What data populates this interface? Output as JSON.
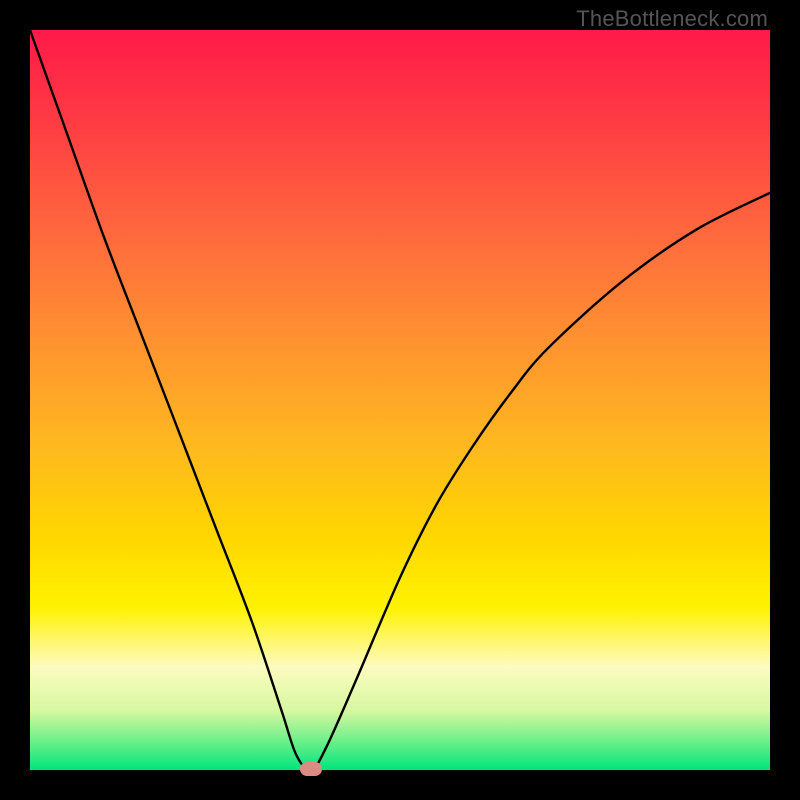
{
  "watermark": "TheBottleneck.com",
  "colors": {
    "top": "#ff1a48",
    "mid": "#ffd500",
    "bottom": "#00e57e",
    "frame": "#000000",
    "curve": "#000000",
    "marker": "#d98b84"
  },
  "chart_data": {
    "type": "line",
    "title": "",
    "xlabel": "",
    "ylabel": "",
    "xlim": [
      0,
      100
    ],
    "ylim": [
      0,
      100
    ],
    "grid": false,
    "x": [
      0,
      5,
      10,
      15,
      20,
      25,
      30,
      34,
      36,
      38,
      40,
      44,
      50,
      55,
      60,
      65,
      70,
      80,
      90,
      100
    ],
    "y": [
      100,
      86,
      72,
      59,
      46,
      33,
      20,
      8,
      2,
      0,
      3,
      12,
      26,
      36,
      44,
      51,
      57,
      66,
      73,
      78
    ],
    "optimum_x": 38,
    "optimum_y": 0,
    "legend": false,
    "annotations": []
  }
}
